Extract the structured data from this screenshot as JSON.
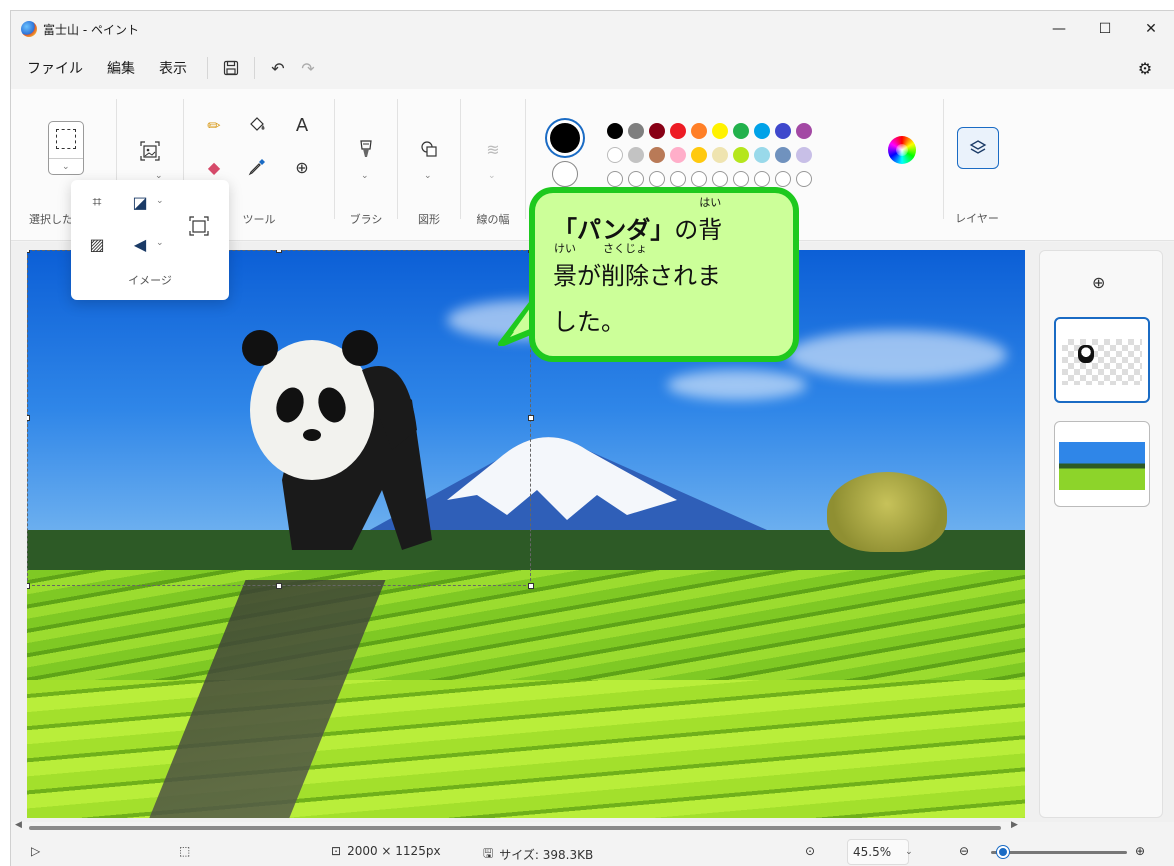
{
  "titlebar": {
    "title": "富士山 - ペイント",
    "minimize": "—",
    "maximize": "☐",
    "close": "✕"
  },
  "menu": {
    "file": "ファイル",
    "edit": "編集",
    "view": "表示"
  },
  "ribbon": {
    "select_label": "選択した",
    "tools_label": "ツール",
    "brush_label": "ブラシ",
    "shapes_label": "図形",
    "stroke_label": "線の幅",
    "layers_label": "レイヤー",
    "image_label": "イメージ"
  },
  "colors": {
    "primary": "#000000",
    "secondary": "#ffffff",
    "row1": [
      "#000000",
      "#7f7f7f",
      "#880015",
      "#ed1c24",
      "#ff7f27",
      "#fff200",
      "#22b14c",
      "#00a2e8",
      "#3f48cc",
      "#a349a4"
    ],
    "row2": [
      "#ffffff",
      "#c3c3c3",
      "#b97a57",
      "#ffaec9",
      "#ffc90e",
      "#efe4b0",
      "#b5e61d",
      "#99d9ea",
      "#7092be",
      "#c8bfe7"
    ]
  },
  "callout": {
    "line1_a": "「パンダ」",
    "line1_b": "の",
    "kanji1": "背",
    "ruby1": "はい",
    "kanji2": "景",
    "ruby2": "けい",
    "line2_b": "が",
    "kanji3": "削除",
    "ruby3": "さくじょ",
    "line2_c": "されま",
    "line3": "した。"
  },
  "status": {
    "dimensions": "2000 × 1125px",
    "size": "サイズ: 398.3KB",
    "zoom": "45.5%",
    "zoom_level": 0.09
  }
}
